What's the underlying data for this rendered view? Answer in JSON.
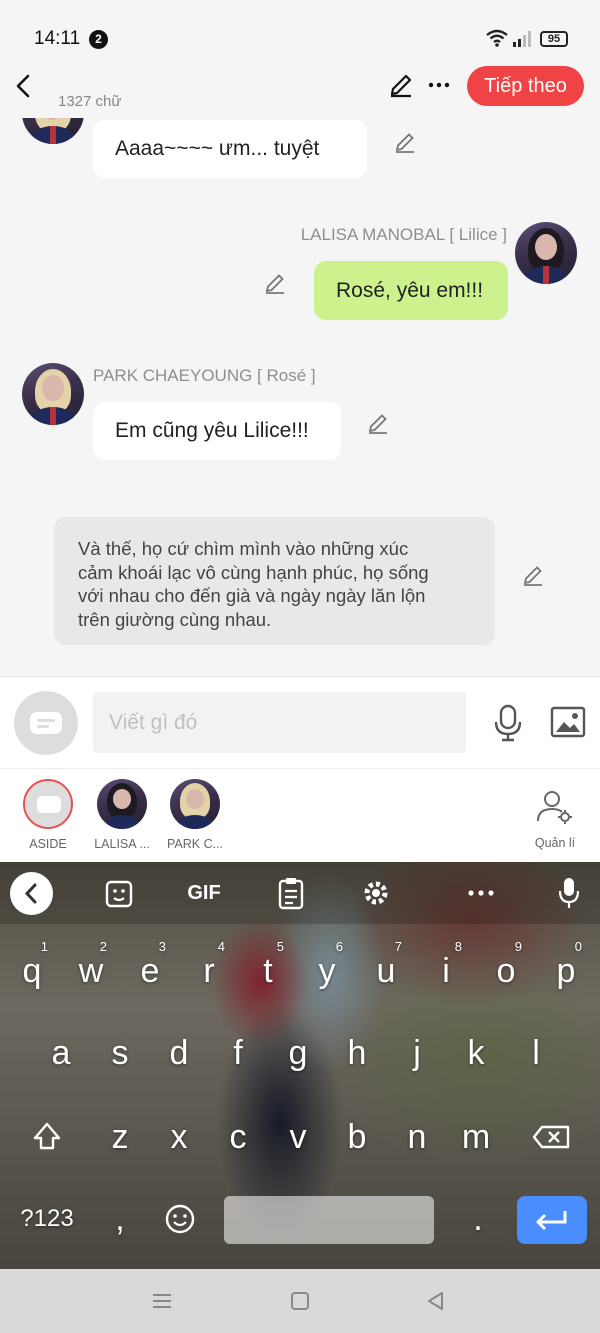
{
  "status_bar": {
    "time": "14:11",
    "notification_count": "2",
    "battery": "95",
    "icons": [
      "wifi-icon",
      "signal-icon",
      "battery-icon"
    ]
  },
  "header": {
    "word_count": "1327 chữ",
    "next_button": "Tiếp theo",
    "accent_color": "#f04345"
  },
  "messages": [
    {
      "type": "partner",
      "text": "Aaaa~~~~ ưm... tuyệt"
    },
    {
      "type": "self",
      "author": "LALISA MANOBAL [ Lilice ]",
      "text": "Rosé, yêu em!!!",
      "bubble_color": "#cdf18c"
    },
    {
      "type": "partner",
      "author": "PARK CHAEYOUNG [ Rosé ]",
      "text": "Em cũng yêu Lilice!!!"
    },
    {
      "type": "aside",
      "lines": [
        "Và thế, họ cứ chìm mình vào những xúc",
        "cảm khoái lạc vô cùng hạnh phúc, họ sống",
        "với nhau cho đến già và ngày ngày lăn lộn",
        "trên giường cùng nhau."
      ]
    }
  ],
  "input": {
    "placeholder": "Viết gì đó"
  },
  "characters": [
    {
      "label": "ASIDE"
    },
    {
      "label": "LALISA ..."
    },
    {
      "label": "PARK C..."
    }
  ],
  "manage_label": "Quản lí",
  "keyboard": {
    "toolbar": [
      "GIF"
    ],
    "row1": [
      {
        "k": "q",
        "n": "1"
      },
      {
        "k": "w",
        "n": "2"
      },
      {
        "k": "e",
        "n": "3"
      },
      {
        "k": "r",
        "n": "4"
      },
      {
        "k": "t",
        "n": "5"
      },
      {
        "k": "y",
        "n": "6"
      },
      {
        "k": "u",
        "n": "7"
      },
      {
        "k": "i",
        "n": "8"
      },
      {
        "k": "o",
        "n": "9"
      },
      {
        "k": "p",
        "n": "0"
      }
    ],
    "row2": [
      "a",
      "s",
      "d",
      "f",
      "g",
      "h",
      "j",
      "k",
      "l"
    ],
    "row3": [
      "z",
      "x",
      "c",
      "v",
      "b",
      "n",
      "m"
    ],
    "row4": {
      "symbols": "?123",
      "comma": ",",
      "period": "."
    }
  }
}
